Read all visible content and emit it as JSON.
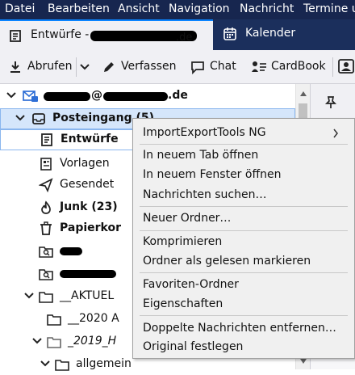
{
  "menubar": {
    "items": [
      "Datei",
      "Bearbeiten",
      "Ansicht",
      "Navigation",
      "Nachricht",
      "Termine u"
    ]
  },
  "tabs": [
    {
      "label": "Entwürfe - ",
      "active": true
    },
    {
      "label": "Kalender",
      "active": false
    }
  ],
  "toolbar": {
    "get_label": "Abrufen",
    "compose_label": "Verfassen",
    "chat_label": "Chat",
    "cardbook_label": "CardBook"
  },
  "account": {
    "label_prefix": "",
    "label_mid": "@",
    "label_suffix": ".de"
  },
  "folders": {
    "inbox": "Posteingang (5)",
    "drafts": "Entwürfe",
    "templates": "Vorlagen",
    "sent": "Gesendet",
    "junk": "Junk (23)",
    "trash": "Papierkor",
    "aktuel": "__AKTUEL",
    "y2020": "__2020 A",
    "y2019": "_2019_H",
    "allgemein": "allgemein"
  },
  "context_menu": {
    "items": [
      {
        "id": "importexport",
        "label": "ImportExportTools NG",
        "submenu": true
      },
      {
        "id": "open-tab",
        "label": "In neuem Tab öffnen"
      },
      {
        "id": "open-window",
        "label": "In neuem Fenster öffnen"
      },
      {
        "id": "search-messages",
        "label": "Nachrichten suchen…"
      },
      {
        "id": "new-folder",
        "label": "Neuer Ordner…"
      },
      {
        "id": "compact",
        "label": "Komprimieren"
      },
      {
        "id": "mark-read",
        "label": "Ordner als gelesen markieren"
      },
      {
        "id": "favorite",
        "label": "Favoriten-Ordner"
      },
      {
        "id": "properties",
        "label": "Eigenschaften"
      },
      {
        "id": "remove-duplicates",
        "label": "Doppelte Nachrichten entfernen…"
      },
      {
        "id": "set-original",
        "label": "Original festlegen"
      }
    ]
  },
  "colors": {
    "menubar_bg": "#17264f",
    "tabstrip_bg": "#1b2f5c",
    "accent": "#0a84ff",
    "selection_bg": "#d5e6fb",
    "folder_icon": "#333333"
  }
}
